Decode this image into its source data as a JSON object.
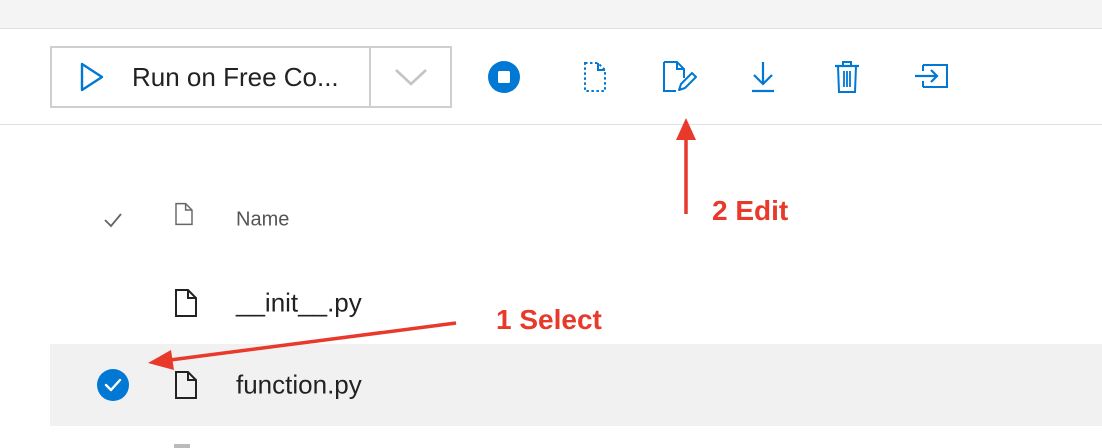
{
  "toolbar": {
    "run_label": "Run on Free Co...",
    "icons": [
      "stop-icon",
      "new-file-icon",
      "edit-file-icon",
      "download-icon",
      "delete-icon",
      "move-icon"
    ]
  },
  "list": {
    "header_name": "Name",
    "files": [
      {
        "name": "__init__.py",
        "selected": false
      },
      {
        "name": "function.py",
        "selected": true
      }
    ]
  },
  "annotations": {
    "select_label": "1 Select",
    "edit_label": "2 Edit"
  },
  "colors": {
    "accent": "#0078d4",
    "annotation": "#e8392b",
    "selected_row": "#f1f1f1"
  }
}
